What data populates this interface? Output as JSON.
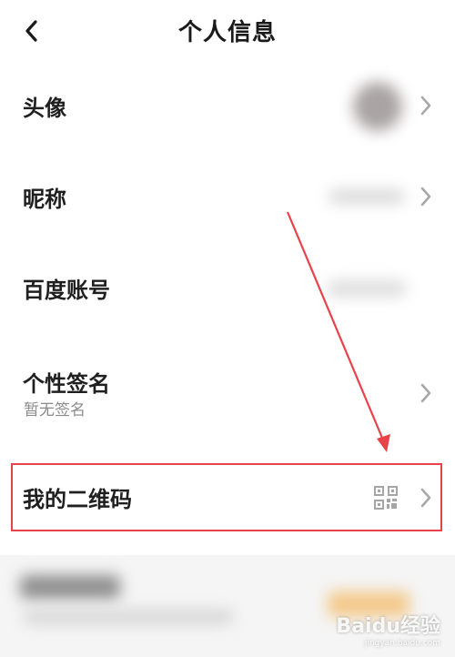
{
  "header": {
    "title": "个人信息",
    "back_icon": "chevron-left-icon"
  },
  "rows": [
    {
      "label": "头像"
    },
    {
      "label": "昵称"
    },
    {
      "label": "百度账号"
    },
    {
      "label": "个性签名",
      "sub": "暂无签名"
    },
    {
      "label": "我的二维码",
      "icon": "qr-code-icon"
    }
  ],
  "annotation": {
    "color": "#e8424a"
  },
  "watermark": {
    "brand": "Baidu经验",
    "url": "jingyan.baidu.com"
  }
}
